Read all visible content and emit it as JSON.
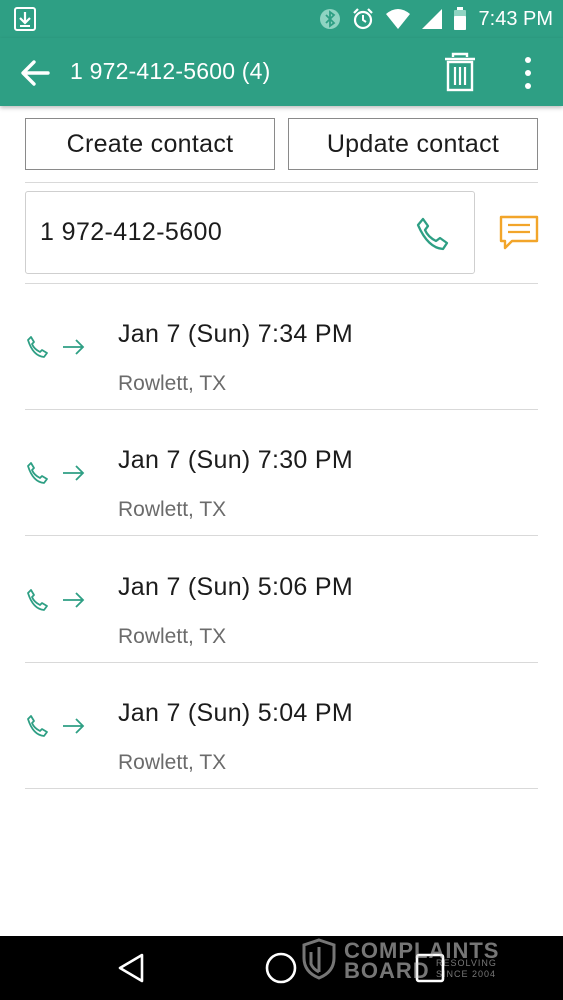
{
  "status_bar": {
    "time": "7:43 PM",
    "icons": [
      "download-icon",
      "bluetooth-icon",
      "alarm-icon",
      "wifi-icon",
      "signal-icon",
      "battery-icon"
    ]
  },
  "app_bar": {
    "title": "1 972-412-5600 (4)",
    "icons": [
      "back-arrow-icon",
      "trash-icon",
      "more-vert-icon"
    ]
  },
  "actions": {
    "create_label": "Create contact",
    "update_label": "Update contact"
  },
  "number_field": {
    "value": "1 972-412-5600",
    "icons": [
      "phone-icon",
      "message-icon"
    ]
  },
  "call_log": [
    {
      "datetime": "Jan 7 (Sun) 7:34 PM",
      "location": "Rowlett, TX",
      "direction": "outgoing"
    },
    {
      "datetime": "Jan 7 (Sun) 7:30 PM",
      "location": "Rowlett, TX",
      "direction": "outgoing"
    },
    {
      "datetime": "Jan 7 (Sun) 5:06 PM",
      "location": "Rowlett, TX",
      "direction": "outgoing"
    },
    {
      "datetime": "Jan 7 (Sun) 5:04 PM",
      "location": "Rowlett, TX",
      "direction": "outgoing"
    }
  ],
  "nav_bar": {
    "icons": [
      "nav-back-icon",
      "nav-home-icon",
      "nav-recents-icon"
    ]
  },
  "watermark": {
    "line1": "COMPLAINTS",
    "line2": "BOARD",
    "tag1": "RESOLVING",
    "tag2": "SINCE 2004"
  },
  "colors": {
    "primary": "#2e9f84",
    "accent": "#f2a52a",
    "divider": "#d9d9d9",
    "secondary_text": "#6b6b6b"
  }
}
